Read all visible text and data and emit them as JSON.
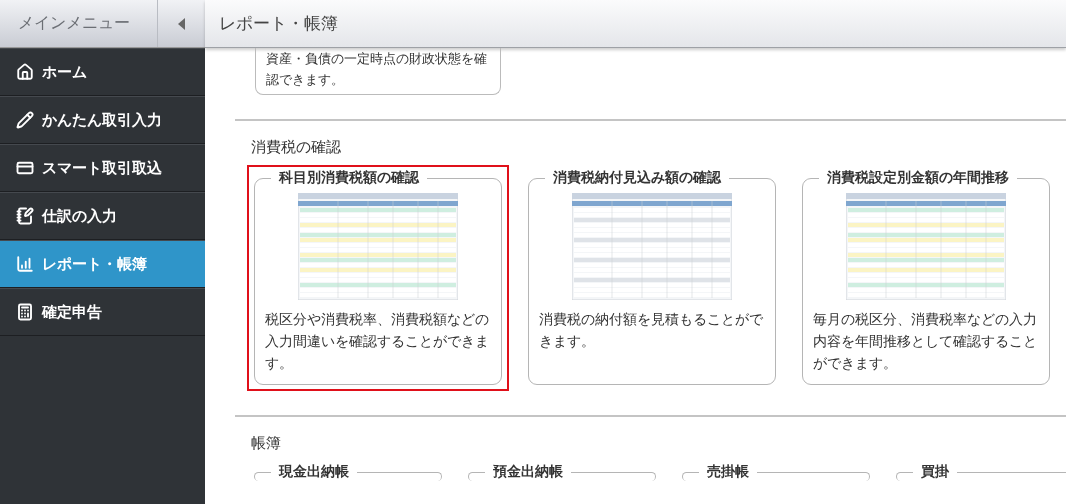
{
  "sidebar": {
    "title": "メインメニュー",
    "items": [
      {
        "label": "ホーム",
        "selected": false
      },
      {
        "label": "かんたん取引入力",
        "selected": false
      },
      {
        "label": "スマート取引取込",
        "selected": false
      },
      {
        "label": "仕訳の入力",
        "selected": false
      },
      {
        "label": "レポート・帳簿",
        "selected": true
      },
      {
        "label": "確定申告",
        "selected": false
      }
    ]
  },
  "header": {
    "title": "レポート・帳簿"
  },
  "top_card": {
    "description": "資産・負債の一定時点の財政状態を確認できます。"
  },
  "sections": [
    {
      "title": "消費税の確認",
      "cards": [
        {
          "title": "科目別消費税額の確認",
          "description": "税区分や消費税率、消費税額などの入力間違いを確認することができます。",
          "selected": true
        },
        {
          "title": "消費税納付見込み額の確認",
          "description": "消費税の納付額を見積もることができます。",
          "selected": false
        },
        {
          "title": "消費税設定別金額の年間推移",
          "description": "毎月の税区分、消費税率などの入力内容を年間推移として確認することができます。",
          "selected": false
        }
      ]
    },
    {
      "title": "帳簿",
      "cards": [
        {
          "title": "現金出納帳",
          "selected": false
        },
        {
          "title": "預金出納帳",
          "selected": false
        },
        {
          "title": "売掛帳",
          "selected": false
        },
        {
          "title": "買掛",
          "selected": false
        }
      ]
    }
  ]
}
